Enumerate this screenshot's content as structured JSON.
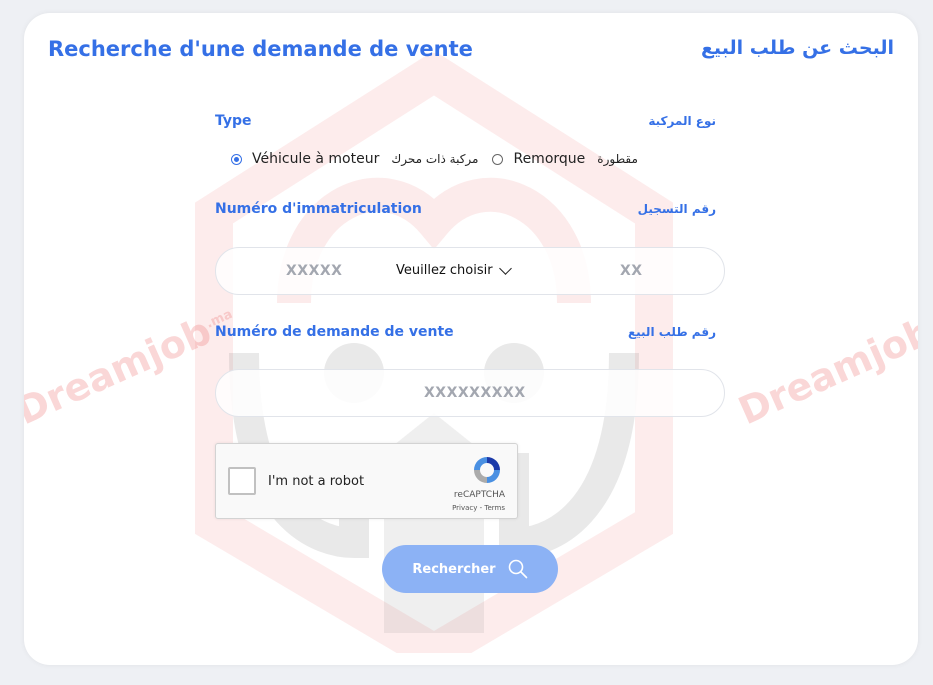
{
  "header": {
    "title_fr": "Recherche d'une demande de vente",
    "title_ar": "البحث عن طلب البيع"
  },
  "type_section": {
    "label_fr": "Type",
    "label_ar": "نوع المركبة",
    "options": [
      {
        "label_fr": "Véhicule à moteur",
        "label_ar": "مركبة ذات محرك",
        "checked": true
      },
      {
        "label_fr": "Remorque",
        "label_ar": "مقطورة",
        "checked": false
      }
    ]
  },
  "registration": {
    "label_fr": "Numéro d'immatriculation",
    "label_ar": "رقم التسجيل",
    "part1_placeholder": "XXXXX",
    "select_value": "Veuillez choisir",
    "part3_placeholder": "XX"
  },
  "sale_request": {
    "label_fr": "Numéro de demande de vente",
    "label_ar": "رقم طلب البيع",
    "placeholder": "XXXXXXXXX"
  },
  "captcha": {
    "label": "I'm not a robot",
    "brand": "reCAPTCHA",
    "links": "Privacy - Terms"
  },
  "search_button": {
    "label": "Rechercher"
  },
  "watermark": {
    "brand": "Dreamjob",
    "suffix": ".ma",
    "color": "#ec6e6e"
  },
  "colors": {
    "accent": "#3570e6",
    "button": "#8cb2f5"
  }
}
